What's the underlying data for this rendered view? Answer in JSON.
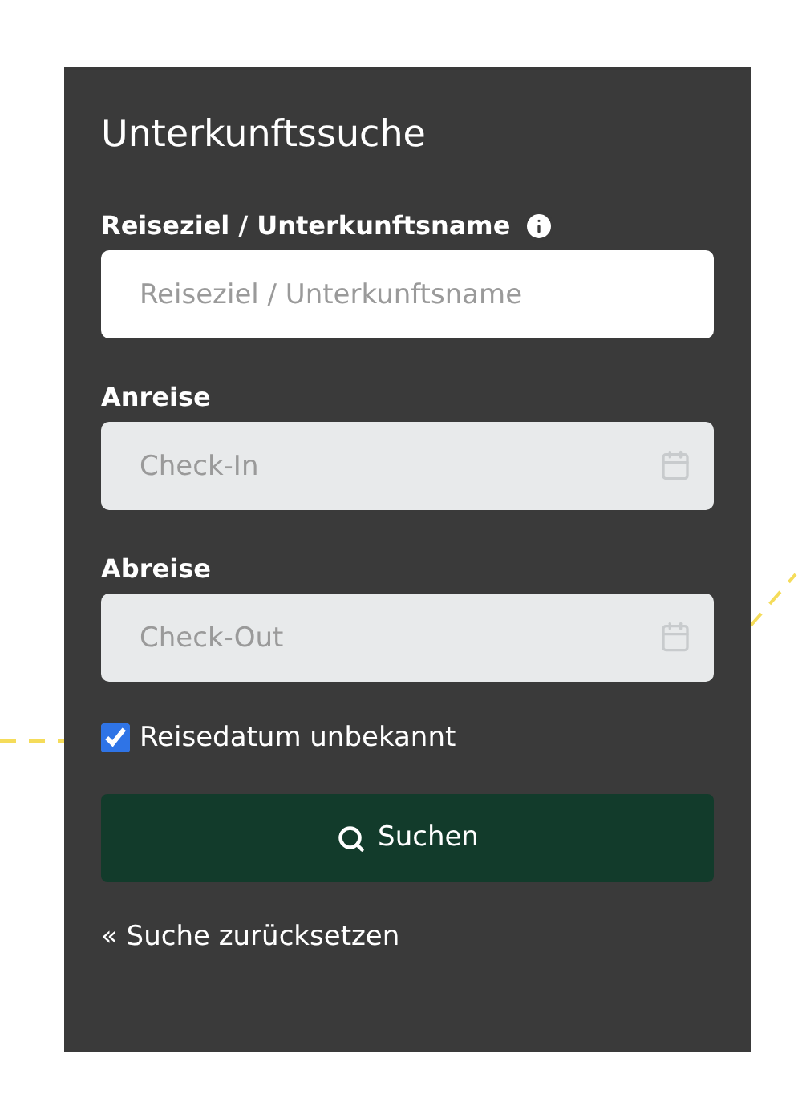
{
  "title": "Unterkunftssuche",
  "fields": [
    {
      "kind": "text",
      "label": "Reiseziel / Unterkunftsname",
      "info": true,
      "placeholder": "Reiseziel / Unterkunftsname",
      "disabled": false
    },
    {
      "kind": "date",
      "label": "Anreise",
      "info": false,
      "placeholder": "Check-In",
      "disabled": true
    },
    {
      "kind": "date",
      "label": "Abreise",
      "info": false,
      "placeholder": "Check-Out",
      "disabled": true
    }
  ],
  "checkbox": {
    "label": "Reisedatum unbekannt",
    "checked": true
  },
  "search_button": {
    "label": "Suchen"
  },
  "reset_link": {
    "label": "« Suche zurücksetzen"
  }
}
